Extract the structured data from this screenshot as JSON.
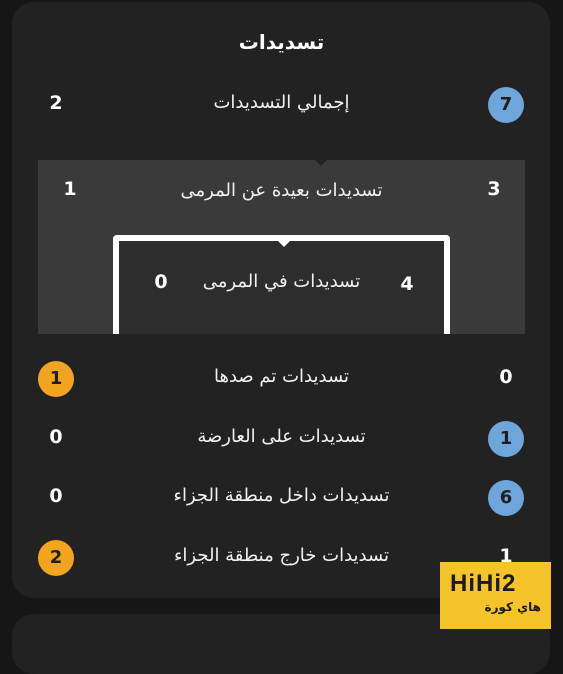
{
  "title": "تسديدات",
  "rows": {
    "total": {
      "label": "إجمالي التسديدات",
      "home": "7",
      "away": "2"
    },
    "off_target": {
      "label": "تسديدات بعيدة عن المرمى",
      "home": "3",
      "away": "1"
    },
    "on_target": {
      "label": "تسديدات في المرمى",
      "home": "4",
      "away": "0"
    },
    "blocked": {
      "label": "تسديدات تم صدها",
      "home": "0",
      "away": "1"
    },
    "woodwork": {
      "label": "تسديدات على العارضة",
      "home": "1",
      "away": "0"
    },
    "inside_box": {
      "label": "تسديدات داخل منطقة الجزاء",
      "home": "6",
      "away": "0"
    },
    "outside_box": {
      "label": "تسديدات خارج منطقة الجزاء",
      "home": "1",
      "away": "2"
    }
  },
  "colors": {
    "card": "#222222",
    "pitch": "#3a3a3a",
    "highlight_blue": "#6ea6dc",
    "highlight_orange": "#f2a41f",
    "logo_bg": "#f4c42a"
  },
  "watermark": {
    "brand": "HiHi2",
    "sub": "هاي كورة"
  }
}
